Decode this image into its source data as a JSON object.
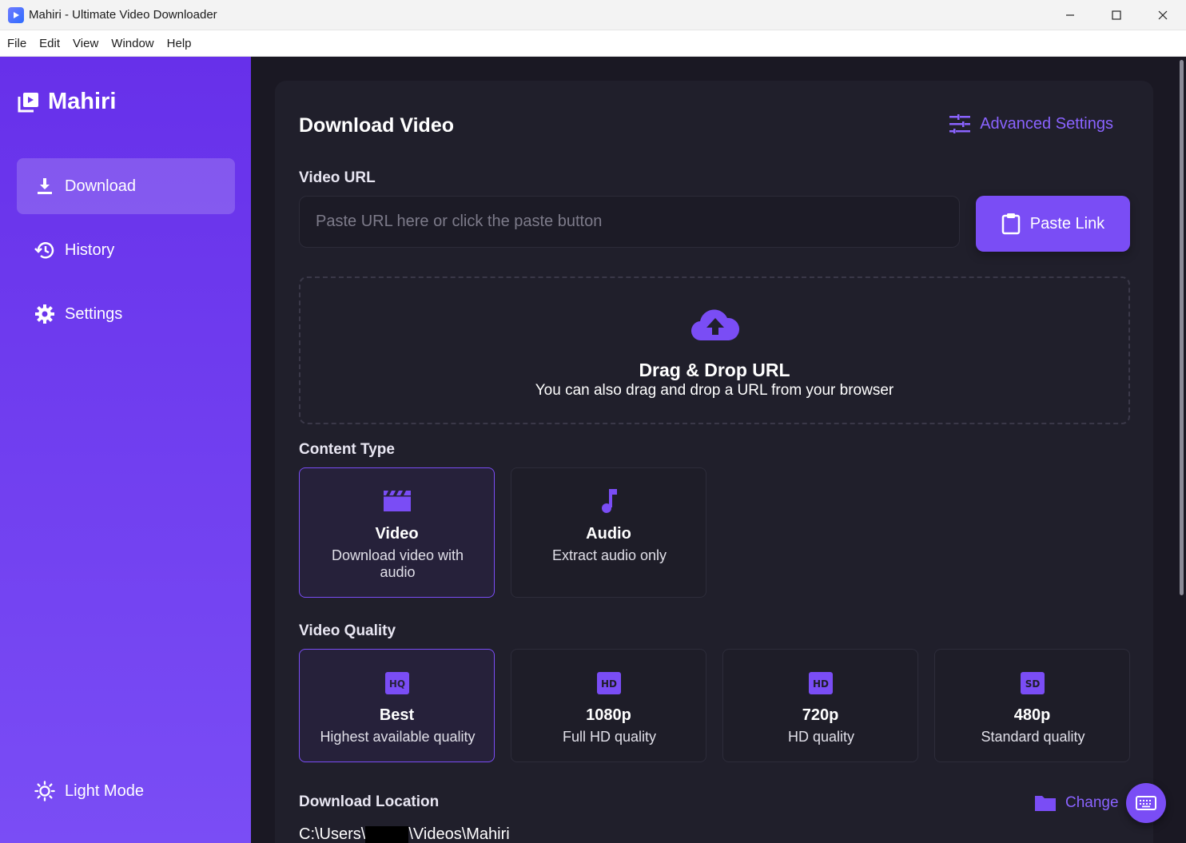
{
  "window": {
    "title": "Mahiri - Ultimate Video Downloader",
    "controls": [
      "minimize",
      "maximize",
      "close"
    ]
  },
  "menu": [
    "File",
    "Edit",
    "View",
    "Window",
    "Help"
  ],
  "sidebar": {
    "brand": "Mahiri",
    "items": [
      {
        "label": "Download",
        "icon": "download-icon",
        "active": true
      },
      {
        "label": "History",
        "icon": "history-icon",
        "active": false
      },
      {
        "label": "Settings",
        "icon": "gear-icon",
        "active": false
      }
    ],
    "theme_toggle": "Light Mode"
  },
  "main": {
    "title": "Download Video",
    "advanced_settings": "Advanced Settings",
    "url_label": "Video URL",
    "url_placeholder": "Paste URL here or click the paste button",
    "url_value": "",
    "paste_button": "Paste Link",
    "dropzone": {
      "title": "Drag & Drop URL",
      "subtitle": "You can also drag and drop a URL from your browser"
    },
    "content_type": {
      "label": "Content Type",
      "options": [
        {
          "title": "Video",
          "subtitle": "Download video with audio",
          "icon": "clapperboard-icon",
          "selected": true
        },
        {
          "title": "Audio",
          "subtitle": "Extract audio only",
          "icon": "music-note-icon",
          "selected": false
        }
      ]
    },
    "video_quality": {
      "label": "Video Quality",
      "options": [
        {
          "badge": "HQ",
          "title": "Best",
          "subtitle": "Highest available quality",
          "selected": true
        },
        {
          "badge": "HD",
          "title": "1080p",
          "subtitle": "Full HD quality",
          "selected": false
        },
        {
          "badge": "HD",
          "title": "720p",
          "subtitle": "HD quality",
          "selected": false
        },
        {
          "badge": "SD",
          "title": "480p",
          "subtitle": "Standard quality",
          "selected": false
        }
      ]
    },
    "location": {
      "label": "Download Location",
      "change_button": "Change",
      "path_prefix": "C:\\Users\\",
      "path_suffix": "\\Videos\\Mahiri"
    }
  },
  "colors": {
    "accent": "#7a4df5",
    "accent_text": "#8a63ff",
    "sidebar_top": "#6730ea",
    "background": "#1a1823",
    "card": "#201f2b"
  }
}
